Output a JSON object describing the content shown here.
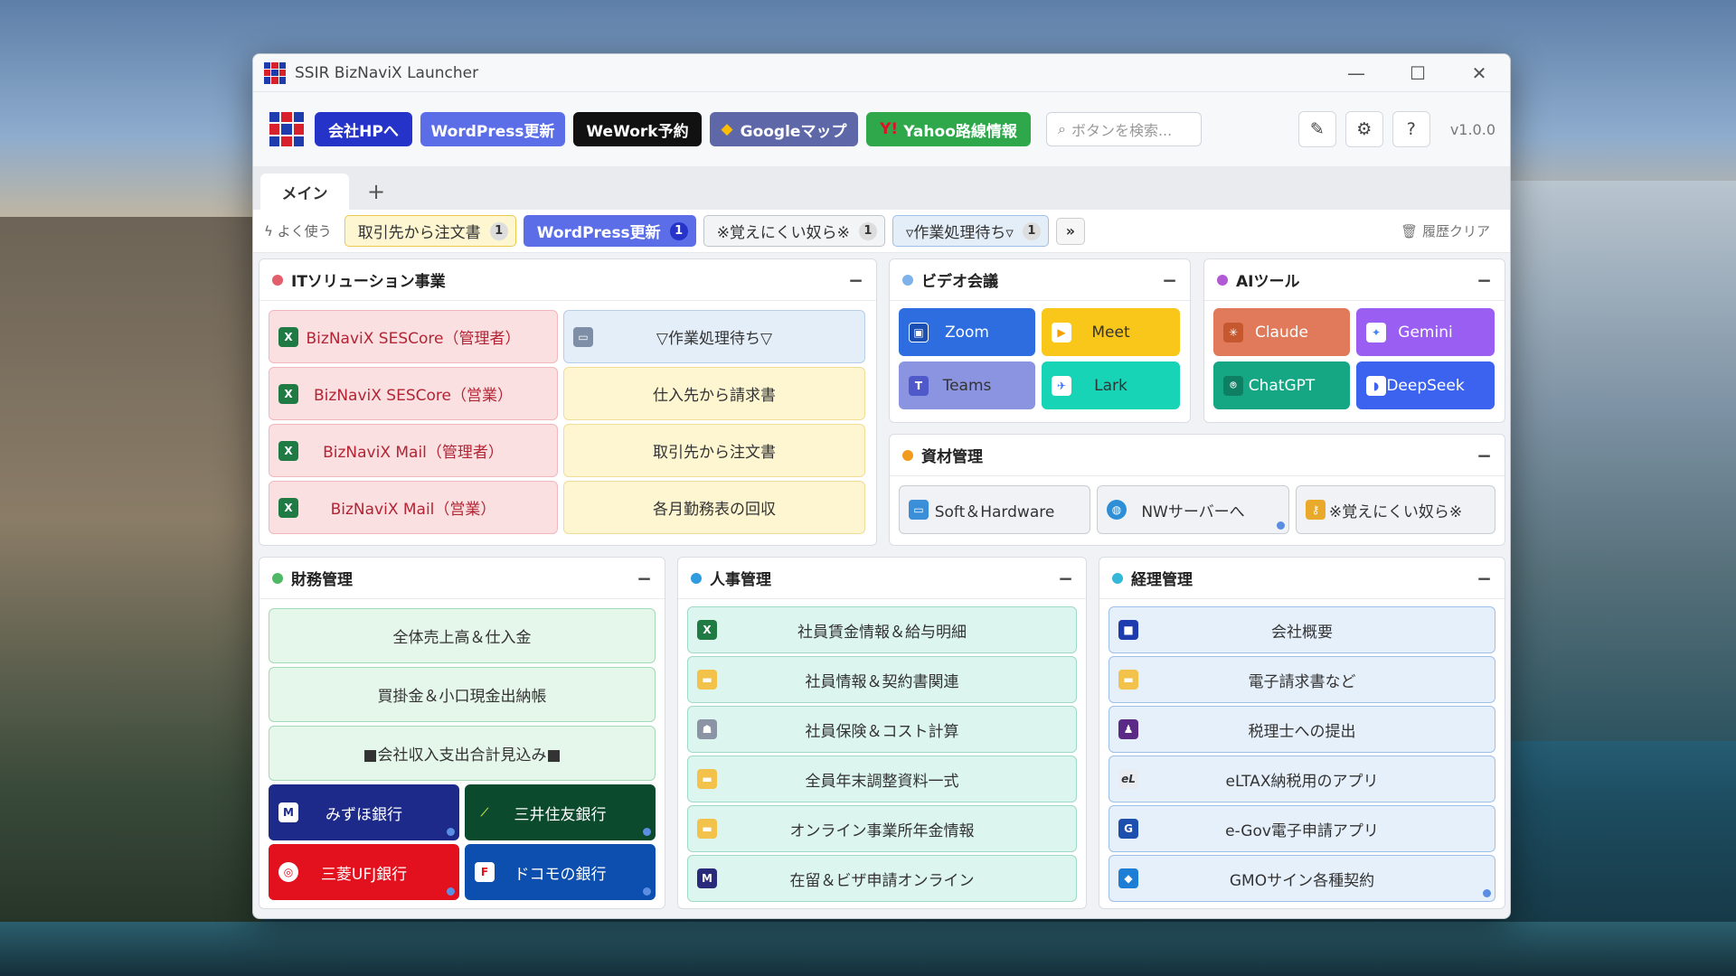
{
  "window": {
    "title": "SSIR BizNaviX Launcher"
  },
  "toolbar": {
    "buttons": [
      {
        "label": "会社HPへ",
        "color": "#2633c9"
      },
      {
        "label": "WordPress更新",
        "color": "#5b6ee8"
      },
      {
        "label": "WeWork予約",
        "color": "#111111"
      },
      {
        "label": "Googleマップ",
        "color": "#5e68a8"
      },
      {
        "label": "Yahoo路線情報",
        "color": "#2ea84b"
      }
    ],
    "search_placeholder": "ボタンを検索...",
    "version": "v1.0.0"
  },
  "tabs": {
    "active": "メイン",
    "add": "+"
  },
  "favorites": {
    "label": "よく使う",
    "chips": [
      {
        "label": "取引先から注文書",
        "count": "1"
      },
      {
        "label": "WordPress更新",
        "count": "1"
      },
      {
        "label": "※覚えにくい奴ら※",
        "count": "1"
      },
      {
        "label": "▿作業処理待ち▿",
        "count": "1"
      }
    ],
    "more": "»",
    "clear": "履歴クリア"
  },
  "panels": {
    "it": {
      "title": "ITソリューション事業",
      "dot": "#e35d6a",
      "items": [
        "BizNaviX SESCore（管理者）",
        "▽作業処理待ち▽",
        "BizNaviX SESCore（営業）",
        "仕入先から請求書",
        "BizNaviX Mail（管理者）",
        "取引先から注文書",
        "BizNaviX Mail（営業）",
        "各月勤務表の回収"
      ]
    },
    "video": {
      "title": "ビデオ会議",
      "dot": "#7db3ea",
      "items": [
        "Zoom",
        "Meet",
        "Teams",
        "Lark"
      ]
    },
    "ai": {
      "title": "AIツール",
      "dot": "#b25ad6",
      "items": [
        "Claude",
        "Gemini",
        "ChatGPT",
        "DeepSeek"
      ]
    },
    "material": {
      "title": "資材管理",
      "dot": "#f29a1f",
      "items": [
        "Soft＆Hardware",
        "NWサーバーへ",
        "※覚えにくい奴ら※"
      ]
    },
    "finance": {
      "title": "財務管理",
      "dot": "#4fb866",
      "items": [
        "全体売上高＆仕入金",
        "買掛金＆小口現金出納帳",
        "■会社収入支出合計見込み■",
        "みずほ銀行",
        "三井住友銀行",
        "三菱UFJ銀行",
        "ドコモの銀行"
      ]
    },
    "hr": {
      "title": "人事管理",
      "dot": "#2f9be0",
      "items": [
        "社員賃金情報＆給与明細",
        "社員情報＆契約書関連",
        "社員保険＆コスト計算",
        "全員年末調整資料一式",
        "オンライン事業所年金情報",
        "在留＆ビザ申請オンライン"
      ]
    },
    "acct": {
      "title": "経理管理",
      "dot": "#35b8d8",
      "items": [
        "会社概要",
        "電子請求書など",
        "税理士への提出",
        "eLTAX納税用のアプリ",
        "e-Gov電子申請アプリ",
        "GMOサイン各種契約"
      ]
    }
  }
}
